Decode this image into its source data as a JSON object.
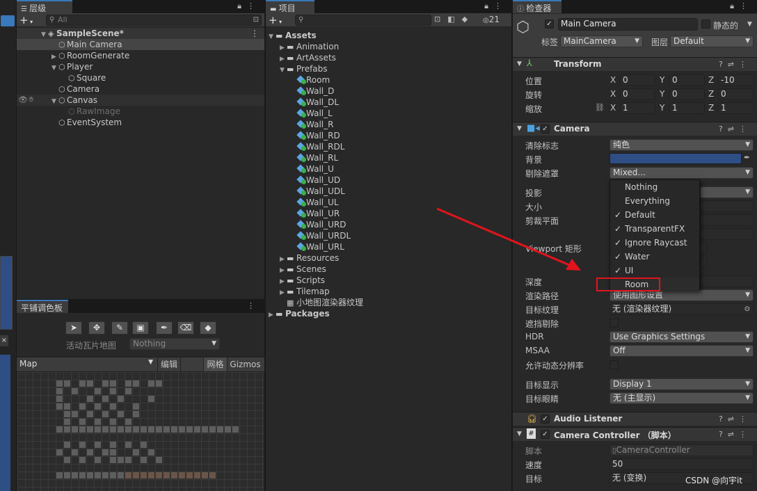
{
  "hierarchy": {
    "tab_label": "层级",
    "search_placeholder": "All",
    "add_label": "+",
    "items": [
      {
        "label": "SampleScene*"
      },
      {
        "label": "Main Camera"
      },
      {
        "label": "RoomGenerate"
      },
      {
        "label": "Player"
      },
      {
        "label": "Square"
      },
      {
        "label": "Camera"
      },
      {
        "label": "Canvas"
      },
      {
        "label": "RawImage"
      },
      {
        "label": "EventSystem"
      }
    ]
  },
  "tile_palette": {
    "tab_label": "平铺调色板",
    "active_tilemap_label": "活动瓦片地图",
    "active_tilemap_value": "Nothing",
    "palette_value": "Map",
    "edit_label": "编辑",
    "grid_label": "网格",
    "gizmos_label": "Gizmos",
    "tools": [
      "select-tool-icon",
      "move-tool-icon",
      "brush-icon",
      "box-fill-icon",
      "picker-icon",
      "eraser-icon",
      "fill-icon"
    ]
  },
  "project": {
    "tab_label": "项目",
    "add_label": "+",
    "hidden_count": "21",
    "items": [
      {
        "label": "Assets"
      },
      {
        "label": "Animation"
      },
      {
        "label": "ArtAssets"
      },
      {
        "label": "Prefabs"
      },
      {
        "label": "Room"
      },
      {
        "label": "Wall_D"
      },
      {
        "label": "Wall_DL"
      },
      {
        "label": "Wall_L"
      },
      {
        "label": "Wall_R"
      },
      {
        "label": "Wall_RD"
      },
      {
        "label": "Wall_RDL"
      },
      {
        "label": "Wall_RL"
      },
      {
        "label": "Wall_U"
      },
      {
        "label": "Wall_UD"
      },
      {
        "label": "Wall_UDL"
      },
      {
        "label": "Wall_UL"
      },
      {
        "label": "Wall_UR"
      },
      {
        "label": "Wall_URD"
      },
      {
        "label": "Wall_URDL"
      },
      {
        "label": "Wall_URL"
      },
      {
        "label": "Resources"
      },
      {
        "label": "Scenes"
      },
      {
        "label": "Scripts"
      },
      {
        "label": "Tilemap"
      },
      {
        "label": "小地图渲染器纹理"
      },
      {
        "label": "Packages"
      }
    ]
  },
  "inspector": {
    "tab_label": "检查器",
    "object_name": "Main Camera",
    "static_label": "静态的",
    "tag_label": "标签",
    "tag_value": "MainCamera",
    "layer_label": "图层",
    "layer_value": "Default",
    "transform": {
      "title": "Transform",
      "position_label": "位置",
      "rotation_label": "旋转",
      "scale_label": "缩放",
      "position": [
        "0",
        "0",
        "-10"
      ],
      "rotation": [
        "0",
        "0",
        "0"
      ],
      "scale": [
        "1",
        "1",
        "1"
      ],
      "axis_x": "X",
      "axis_y": "Y",
      "axis_z": "Z"
    },
    "camera": {
      "title": "Camera",
      "clear_flags_label": "清除标志",
      "clear_flags_value": "纯色",
      "background_label": "背景",
      "background_color": "#2f4e86",
      "culling_mask_label": "剔除遮罩",
      "culling_mask_value": "Mixed...",
      "projection_label": "投影",
      "size_label": "大小",
      "clipping_label": "剪裁平面",
      "viewport_label": "Viewport 矩形",
      "depth_label": "深度",
      "render_path_label": "渲染路径",
      "render_path_value": "使用图形设置",
      "target_texture_label": "目标纹理",
      "target_texture_value": "无 (渲染器纹理)",
      "occlusion_label": "遮挡剔除",
      "hdr_label": "HDR",
      "hdr_value": "Use Graphics Settings",
      "msaa_label": "MSAA",
      "msaa_value": "Off",
      "dynamic_res_label": "允许动态分辨率",
      "target_display_label": "目标显示",
      "target_display_value": "Display 1",
      "target_eye_label": "目标眼睛",
      "target_eye_value": "无 (主显示)"
    },
    "audio_listener": {
      "title": "Audio Listener"
    },
    "camera_controller": {
      "title": "Camera Controller （脚本）",
      "script_label": "脚本",
      "script_value": "CameraController",
      "speed_label": "速度",
      "speed_value": "50",
      "target_label": "目标",
      "target_value": "无 (变换)"
    }
  },
  "culling_menu": {
    "items": [
      {
        "label": "Nothing",
        "checked": false
      },
      {
        "label": "Everything",
        "checked": false
      },
      {
        "label": "Default",
        "checked": true
      },
      {
        "label": "TransparentFX",
        "checked": true
      },
      {
        "label": "Ignore Raycast",
        "checked": true
      },
      {
        "label": "Water",
        "checked": true
      },
      {
        "label": "UI",
        "checked": true
      },
      {
        "label": "Room",
        "checked": false
      }
    ],
    "check_glyph": "✓"
  },
  "watermark": "CSDN @向宇it",
  "colors": {
    "annotation_red": "#e0141c",
    "selection_blue": "#3a79bb"
  }
}
